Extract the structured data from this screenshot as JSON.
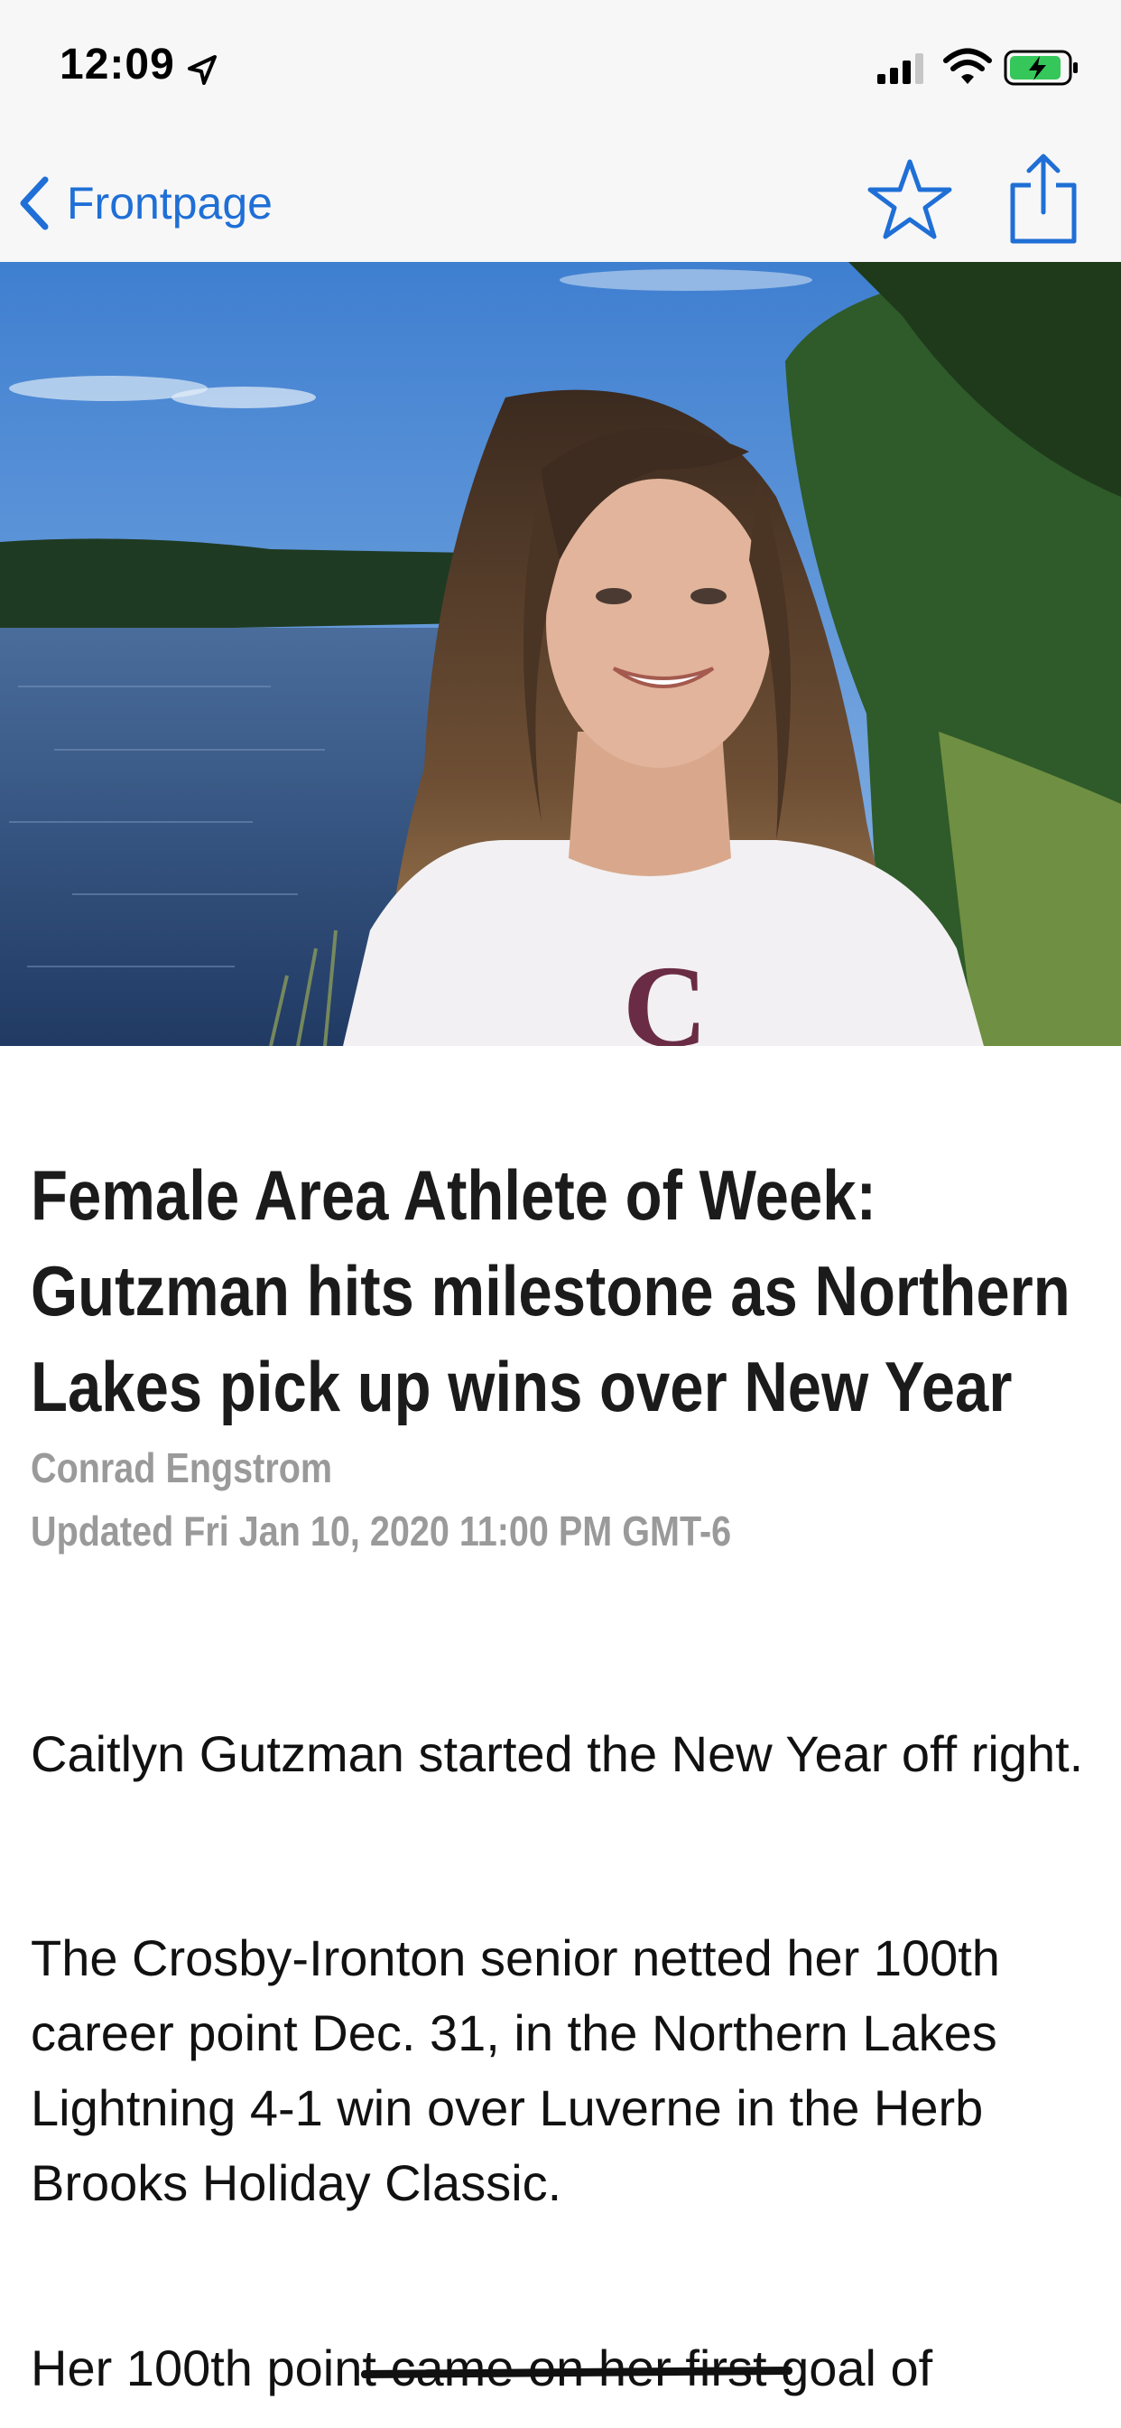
{
  "status_bar": {
    "time": "12:09",
    "icons": [
      "location-arrow-icon",
      "cellular-signal-icon",
      "wifi-icon",
      "battery-charging-icon"
    ]
  },
  "nav": {
    "back_label": "Frontpage",
    "accent_color": "#1f6fd6",
    "icons": [
      "chevron-left-icon",
      "star-icon",
      "share-icon"
    ]
  },
  "hero_image": {
    "shirt_monogram": "C"
  },
  "article": {
    "headline": "Female Area Athlete of Week: Gutzman hits milestone as Northern Lakes pick up wins over New Year",
    "author": "Conrad Engstrom",
    "updated": "Updated Fri Jan 10, 2020 11:00 PM GMT-6",
    "paragraphs": [
      "Caitlyn Gutzman started the New Year off right.",
      "The Crosby-Ironton senior netted her 100th career point Dec. 31, in the Northern Lakes Lightning 4-1 win over Luverne in the Herb Brooks Holiday Classic.",
      "Her 100th point came on her first goal of"
    ]
  }
}
